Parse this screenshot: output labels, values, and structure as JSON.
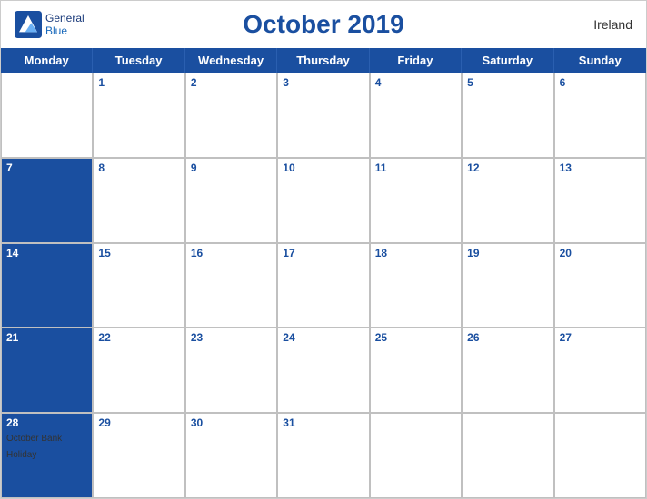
{
  "header": {
    "title": "October 2019",
    "country": "Ireland",
    "logo_line1": "General",
    "logo_line2": "Blue"
  },
  "days": [
    "Monday",
    "Tuesday",
    "Wednesday",
    "Thursday",
    "Friday",
    "Saturday",
    "Sunday"
  ],
  "weeks": [
    [
      {
        "date": "",
        "events": []
      },
      {
        "date": "1",
        "events": []
      },
      {
        "date": "2",
        "events": []
      },
      {
        "date": "3",
        "events": []
      },
      {
        "date": "4",
        "events": []
      },
      {
        "date": "5",
        "events": []
      },
      {
        "date": "6",
        "events": []
      }
    ],
    [
      {
        "date": "7",
        "events": []
      },
      {
        "date": "8",
        "events": []
      },
      {
        "date": "9",
        "events": []
      },
      {
        "date": "10",
        "events": []
      },
      {
        "date": "11",
        "events": []
      },
      {
        "date": "12",
        "events": []
      },
      {
        "date": "13",
        "events": []
      }
    ],
    [
      {
        "date": "14",
        "events": []
      },
      {
        "date": "15",
        "events": []
      },
      {
        "date": "16",
        "events": []
      },
      {
        "date": "17",
        "events": []
      },
      {
        "date": "18",
        "events": []
      },
      {
        "date": "19",
        "events": []
      },
      {
        "date": "20",
        "events": []
      }
    ],
    [
      {
        "date": "21",
        "events": []
      },
      {
        "date": "22",
        "events": []
      },
      {
        "date": "23",
        "events": []
      },
      {
        "date": "24",
        "events": []
      },
      {
        "date": "25",
        "events": []
      },
      {
        "date": "26",
        "events": []
      },
      {
        "date": "27",
        "events": []
      }
    ],
    [
      {
        "date": "28",
        "events": [
          "October Bank Holiday"
        ]
      },
      {
        "date": "29",
        "events": []
      },
      {
        "date": "30",
        "events": []
      },
      {
        "date": "31",
        "events": []
      },
      {
        "date": "",
        "events": []
      },
      {
        "date": "",
        "events": []
      },
      {
        "date": "",
        "events": []
      }
    ]
  ]
}
